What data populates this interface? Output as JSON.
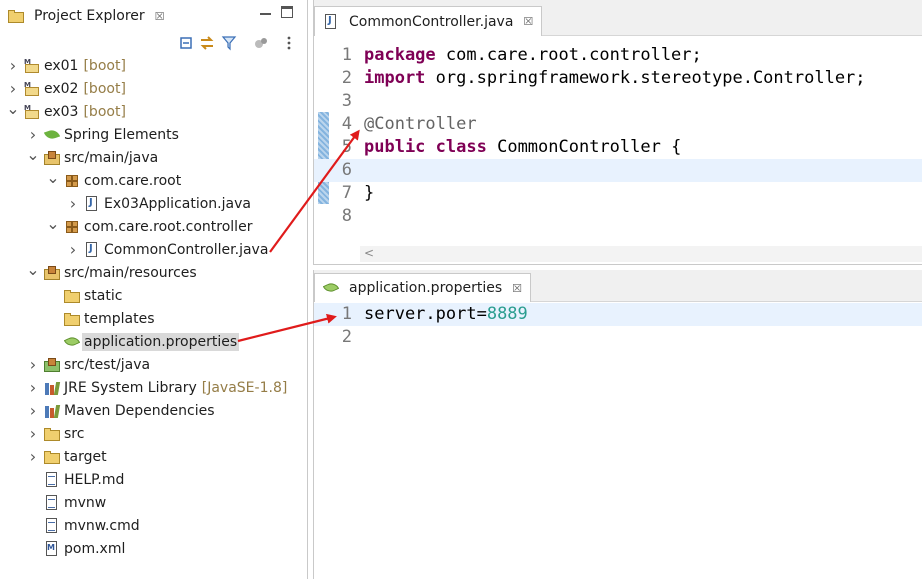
{
  "explorer": {
    "title": "Project Explorer",
    "close_glyph": "☒",
    "toolbar_icons": [
      "collapse-all-icon",
      "link-with-editor-icon",
      "filter-icon",
      "focus-icon",
      "view-menu-icon"
    ],
    "tree": [
      {
        "label": "ex01",
        "decoration": "[boot]",
        "icon": "maven-project-icon",
        "state": "collapsed"
      },
      {
        "label": "ex02",
        "decoration": "[boot]",
        "icon": "maven-project-icon",
        "state": "collapsed"
      },
      {
        "label": "ex03",
        "decoration": "[boot]",
        "icon": "maven-project-icon",
        "state": "expanded"
      },
      {
        "label": "Spring Elements",
        "icon": "spring-icon",
        "state": "collapsed"
      },
      {
        "label": "src/main/java",
        "icon": "source-folder-icon",
        "state": "expanded"
      },
      {
        "label": "com.care.root",
        "icon": "package-icon",
        "state": "expanded"
      },
      {
        "label": "Ex03Application.java",
        "icon": "java-file-icon",
        "state": "collapsed"
      },
      {
        "label": "com.care.root.controller",
        "icon": "package-icon",
        "state": "expanded"
      },
      {
        "label": "CommonController.java",
        "icon": "java-file-icon",
        "state": "collapsed"
      },
      {
        "label": "src/main/resources",
        "icon": "source-folder-icon",
        "state": "expanded"
      },
      {
        "label": "static",
        "icon": "folder-icon",
        "state": "none"
      },
      {
        "label": "templates",
        "icon": "folder-icon",
        "state": "none"
      },
      {
        "label": "application.properties",
        "icon": "properties-file-icon",
        "state": "none",
        "selected": true
      },
      {
        "label": "src/test/java",
        "icon": "test-source-folder-icon",
        "state": "collapsed"
      },
      {
        "label": "JRE System Library",
        "decoration": "[JavaSE-1.8]",
        "icon": "library-icon",
        "state": "collapsed"
      },
      {
        "label": "Maven Dependencies",
        "icon": "library-icon",
        "state": "collapsed"
      },
      {
        "label": "src",
        "icon": "folder-icon",
        "state": "collapsed"
      },
      {
        "label": "target",
        "icon": "folder-icon",
        "state": "collapsed"
      },
      {
        "label": "HELP.md",
        "icon": "text-file-icon",
        "state": "none"
      },
      {
        "label": "mvnw",
        "icon": "text-file-icon",
        "state": "none"
      },
      {
        "label": "mvnw.cmd",
        "icon": "text-file-icon",
        "state": "none"
      },
      {
        "label": "pom.xml",
        "icon": "pom-file-icon",
        "state": "none"
      }
    ]
  },
  "editor_java": {
    "tab_label": "CommonController.java",
    "close_glyph": "☒",
    "lines": [
      {
        "n": "1",
        "tokens": [
          {
            "t": "package",
            "c": "kw"
          },
          {
            "t": " com.care.root.controller;",
            "c": "txt"
          }
        ]
      },
      {
        "n": "2",
        "tokens": [
          {
            "t": "import",
            "c": "kw"
          },
          {
            "t": " org.springframework.stereotype.Controller;",
            "c": "txt"
          }
        ]
      },
      {
        "n": "3",
        "tokens": []
      },
      {
        "n": "4",
        "tokens": [
          {
            "t": "@Controller",
            "c": "ann"
          }
        ]
      },
      {
        "n": "5",
        "tokens": [
          {
            "t": "public",
            "c": "kw"
          },
          {
            "t": " ",
            "c": "txt"
          },
          {
            "t": "class",
            "c": "kw"
          },
          {
            "t": " CommonController {",
            "c": "txt"
          }
        ]
      },
      {
        "n": "6",
        "tokens": [],
        "current": true
      },
      {
        "n": "7",
        "tokens": [
          {
            "t": "}",
            "c": "txt"
          }
        ]
      },
      {
        "n": "8",
        "tokens": []
      }
    ],
    "scroll_glyph": "<"
  },
  "editor_props": {
    "tab_label": "application.properties",
    "close_glyph": "☒",
    "lines": [
      {
        "n": "1",
        "tokens": [
          {
            "t": "server.port=",
            "c": "txt"
          },
          {
            "t": "8889",
            "c": "num"
          }
        ],
        "current": true
      },
      {
        "n": "2",
        "tokens": []
      }
    ]
  },
  "colors": {
    "keyword": "#7f0055",
    "annotation": "#646464",
    "number": "#2a9d8f",
    "arrow": "#e01b1b",
    "current_line": "#e8f2fe",
    "selection": "#d9d9d9"
  }
}
